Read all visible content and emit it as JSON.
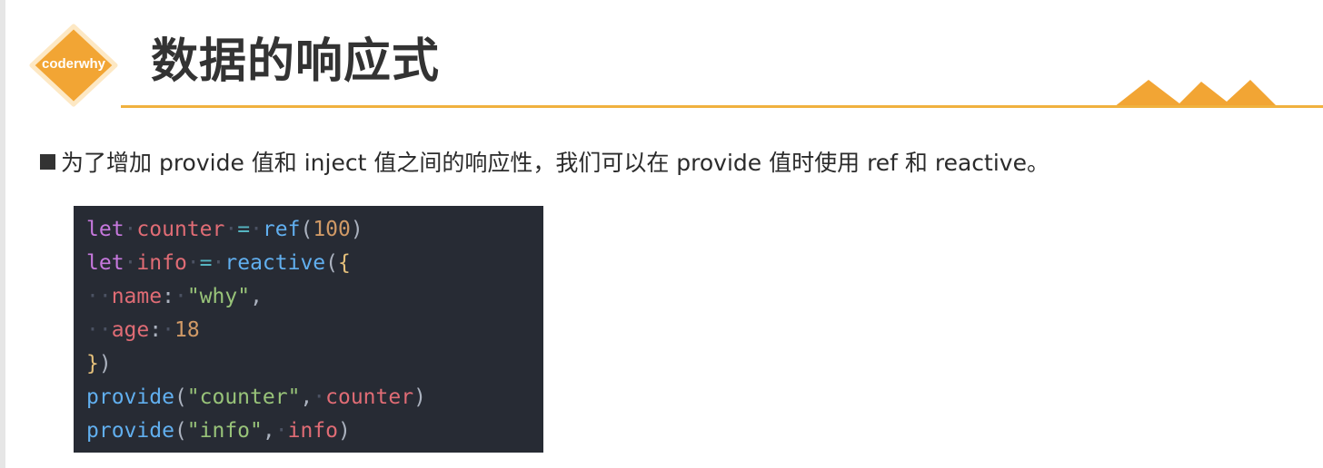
{
  "logo": {
    "text": "coderwhy"
  },
  "title": "数据的响应式",
  "bullet": {
    "text": "为了增加 provide 值和 inject 值之间的响应性，我们可以在 provide 值时使用 ref 和 reactive。"
  },
  "code": {
    "lines": [
      [
        {
          "t": "let",
          "c": "kw"
        },
        {
          "t": "·",
          "c": "ws"
        },
        {
          "t": "counter",
          "c": "var"
        },
        {
          "t": "·",
          "c": "ws"
        },
        {
          "t": "=",
          "c": "op"
        },
        {
          "t": "·",
          "c": "ws"
        },
        {
          "t": "ref",
          "c": "fn"
        },
        {
          "t": "(",
          "c": "pun"
        },
        {
          "t": "100",
          "c": "num"
        },
        {
          "t": ")",
          "c": "pun"
        }
      ],
      [
        {
          "t": "let",
          "c": "kw"
        },
        {
          "t": "·",
          "c": "ws"
        },
        {
          "t": "info",
          "c": "var"
        },
        {
          "t": "·",
          "c": "ws"
        },
        {
          "t": "=",
          "c": "op"
        },
        {
          "t": "·",
          "c": "ws"
        },
        {
          "t": "reactive",
          "c": "fn"
        },
        {
          "t": "(",
          "c": "pun"
        },
        {
          "t": "{",
          "c": "br"
        }
      ],
      [
        {
          "t": "··",
          "c": "ws"
        },
        {
          "t": "name",
          "c": "var"
        },
        {
          "t": ":",
          "c": "pun"
        },
        {
          "t": "·",
          "c": "ws"
        },
        {
          "t": "\"why\"",
          "c": "str"
        },
        {
          "t": ",",
          "c": "pun"
        }
      ],
      [
        {
          "t": "··",
          "c": "ws"
        },
        {
          "t": "age",
          "c": "var"
        },
        {
          "t": ":",
          "c": "pun"
        },
        {
          "t": "·",
          "c": "ws"
        },
        {
          "t": "18",
          "c": "num"
        }
      ],
      [
        {
          "t": "}",
          "c": "br"
        },
        {
          "t": ")",
          "c": "pun"
        }
      ],
      [
        {
          "t": "provide",
          "c": "fn"
        },
        {
          "t": "(",
          "c": "pun"
        },
        {
          "t": "\"counter\"",
          "c": "str"
        },
        {
          "t": ",",
          "c": "pun"
        },
        {
          "t": "·",
          "c": "ws"
        },
        {
          "t": "counter",
          "c": "var"
        },
        {
          "t": ")",
          "c": "pun"
        }
      ],
      [
        {
          "t": "provide",
          "c": "fn"
        },
        {
          "t": "(",
          "c": "pun"
        },
        {
          "t": "\"info\"",
          "c": "str"
        },
        {
          "t": ",",
          "c": "pun"
        },
        {
          "t": "·",
          "c": "ws"
        },
        {
          "t": "info",
          "c": "var"
        },
        {
          "t": ")",
          "c": "pun"
        }
      ]
    ]
  },
  "colors": {
    "accent": "#f0b13e",
    "logo": "#f2a534",
    "code_bg": "#272b34"
  }
}
